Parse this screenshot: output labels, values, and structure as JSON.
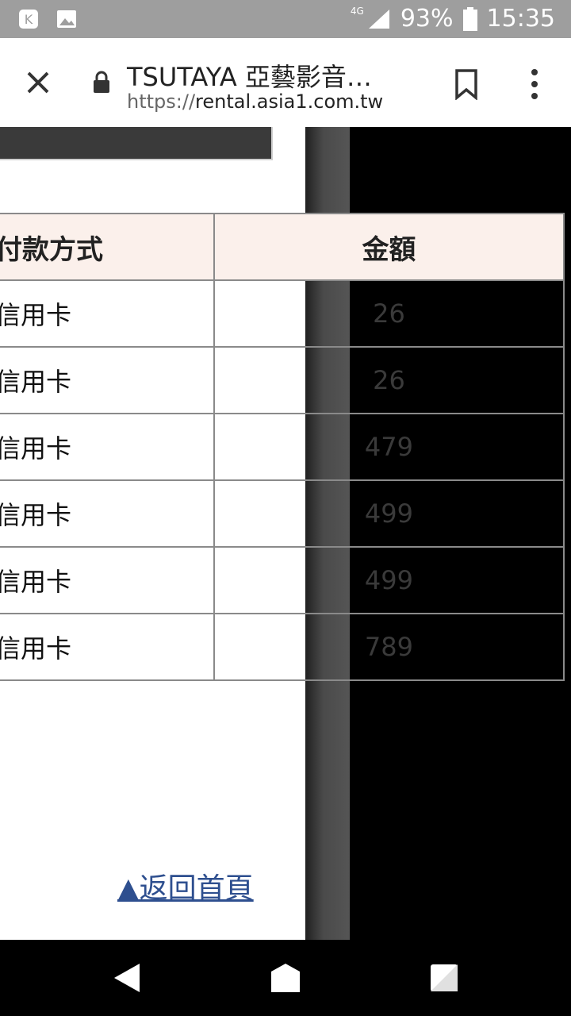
{
  "status": {
    "network": "4G",
    "battery": "93%",
    "time": "15:35"
  },
  "browser": {
    "title": "TSUTAYA 亞藝影音…",
    "url_scheme": "https://",
    "url_host": "rental.asia1.com.tw"
  },
  "table": {
    "headers": [
      "付款方式",
      "金額"
    ],
    "rows": [
      {
        "method": "信用卡",
        "amount": "26"
      },
      {
        "method": "信用卡",
        "amount": "26"
      },
      {
        "method": "信用卡",
        "amount": "479"
      },
      {
        "method": "信用卡",
        "amount": "499"
      },
      {
        "method": "信用卡",
        "amount": "499"
      },
      {
        "method": "信用卡",
        "amount": "789"
      }
    ]
  },
  "footer": {
    "back_home": "▲返回首頁"
  },
  "colors": {
    "link": "#2e4f8f",
    "header_bg": "#fbf0eb"
  }
}
